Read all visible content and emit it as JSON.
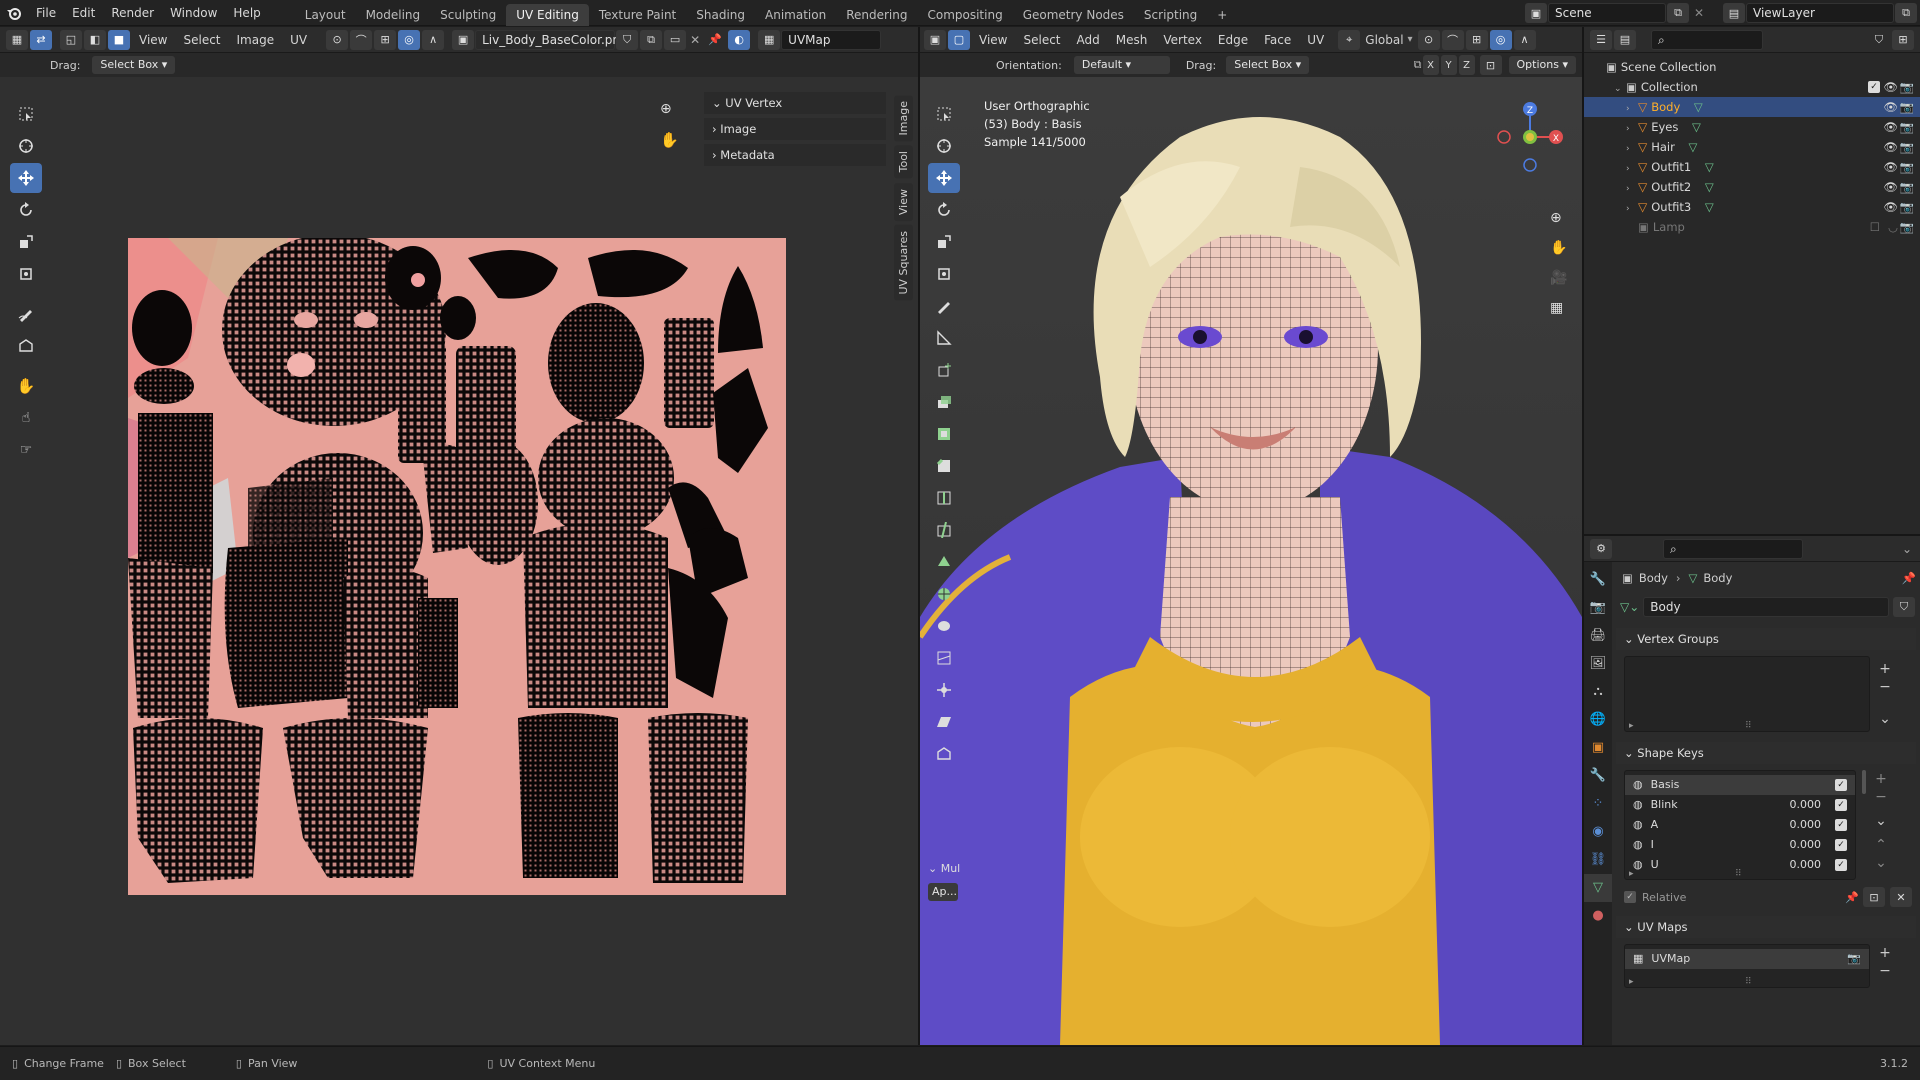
{
  "topbar": {
    "menus": [
      "File",
      "Edit",
      "Render",
      "Window",
      "Help"
    ],
    "workspaces": [
      "Layout",
      "Modeling",
      "Sculpting",
      "UV Editing",
      "Texture Paint",
      "Shading",
      "Animation",
      "Rendering",
      "Compositing",
      "Geometry Nodes",
      "Scripting"
    ],
    "active_workspace": "UV Editing",
    "add_tab": "+",
    "scene": "Scene",
    "view_layer": "ViewLayer"
  },
  "uv_editor": {
    "menus": [
      "View",
      "Select",
      "Image",
      "UV"
    ],
    "image_name": "Liv_Body_BaseColor.png",
    "uvmap": "UVMap",
    "drag_label": "Drag:",
    "drag_value": "Select Box",
    "sidebar_panels": [
      "UV Vertex",
      "Image",
      "Metadata"
    ],
    "vertical_tabs": [
      "Image",
      "Tool",
      "View",
      "UV Squares"
    ]
  },
  "viewport": {
    "menus": [
      "View",
      "Select",
      "Add",
      "Mesh",
      "Vertex",
      "Edge",
      "Face",
      "UV"
    ],
    "transform": "Global",
    "orientation_label": "Orientation:",
    "orientation_value": "Default",
    "drag_label": "Drag:",
    "drag_value": "Select Box",
    "axes": [
      "X",
      "Y",
      "Z"
    ],
    "options": "Options",
    "info_lines": [
      "User Orthographic",
      "(53) Body : Basis",
      "Sample 141/5000"
    ],
    "last_op": "Mul",
    "last_op_sub": "Ap..."
  },
  "outliner": {
    "root": "Scene Collection",
    "collection": "Collection",
    "objects": [
      "Body",
      "Eyes",
      "Hair",
      "Outfit1",
      "Outfit2",
      "Outfit3"
    ],
    "extra": "Lamp",
    "active": "Body"
  },
  "properties": {
    "breadcrumb": [
      "Body",
      "Body"
    ],
    "mesh_name": "Body",
    "vertex_groups": "Vertex Groups",
    "shape_keys_title": "Shape Keys",
    "shape_keys": [
      {
        "name": "Basis",
        "value": ""
      },
      {
        "name": "Blink",
        "value": "0.000"
      },
      {
        "name": "A",
        "value": "0.000"
      },
      {
        "name": "I",
        "value": "0.000"
      },
      {
        "name": "U",
        "value": "0.000"
      }
    ],
    "relative": "Relative",
    "uv_maps_title": "UV Maps",
    "uv_map_item": "UVMap"
  },
  "statusbar": {
    "items": [
      "Change Frame",
      "Box Select",
      "Pan View",
      "UV Context Menu"
    ],
    "version": "3.1.2"
  },
  "colors": {
    "accent": "#4772b3",
    "uv_bg": "#e7a198",
    "object_orange": "#e0892f",
    "mesh_green": "#6cc08b"
  }
}
